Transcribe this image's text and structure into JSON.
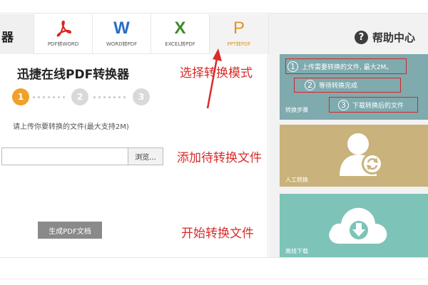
{
  "brand": {
    "text": "器"
  },
  "tabs": [
    {
      "letter": "",
      "label": "PDF转WORD",
      "color": "#d9261c",
      "icon": "acrobat-icon"
    },
    {
      "letter": "W",
      "label": "WORD转PDF",
      "color": "#2b6cc4",
      "icon": "word-icon"
    },
    {
      "letter": "X",
      "label": "EXCEL转PDF",
      "color": "#3e8a2c",
      "icon": "excel-icon"
    },
    {
      "letter": "P",
      "label": "PPT转PDF",
      "color": "#e0942a",
      "icon": "powerpoint-icon",
      "active": true
    }
  ],
  "converter": {
    "title": "迅捷在线PDF转换器",
    "steps": [
      "1",
      "2",
      "3"
    ],
    "active_step": 1,
    "upload_hint": "请上传你要转换的文件(最大支持2M)",
    "file_input_value": "",
    "browse_label": "浏览...",
    "generate_label": "生成PDF文档"
  },
  "annotations": {
    "select_mode": "选择转换模式",
    "add_file": "添加待转换文件",
    "start_convert": "开始转换文件"
  },
  "help": {
    "title": "帮助中心",
    "icon": "question-icon",
    "steps_card": {
      "label": "转换步骤",
      "items": [
        {
          "num": "1",
          "text": "上传需要转换的文件, 最大2M。"
        },
        {
          "num": "2",
          "text": "等待转换完成"
        },
        {
          "num": "3",
          "text": "下载转换后的文件"
        }
      ]
    },
    "manual_card": {
      "label": "人工转换",
      "icon": "user-refresh-icon"
    },
    "offline_card": {
      "label": "离线下载",
      "icon": "cloud-download-icon"
    }
  },
  "colors": {
    "accent": "#f0a12a",
    "annotation_red": "#d92b2b",
    "steps_card": "#7faaae",
    "manual_card": "#c9b27c",
    "offline_card": "#7ec3b8",
    "generate_button": "#8a8a8a"
  }
}
